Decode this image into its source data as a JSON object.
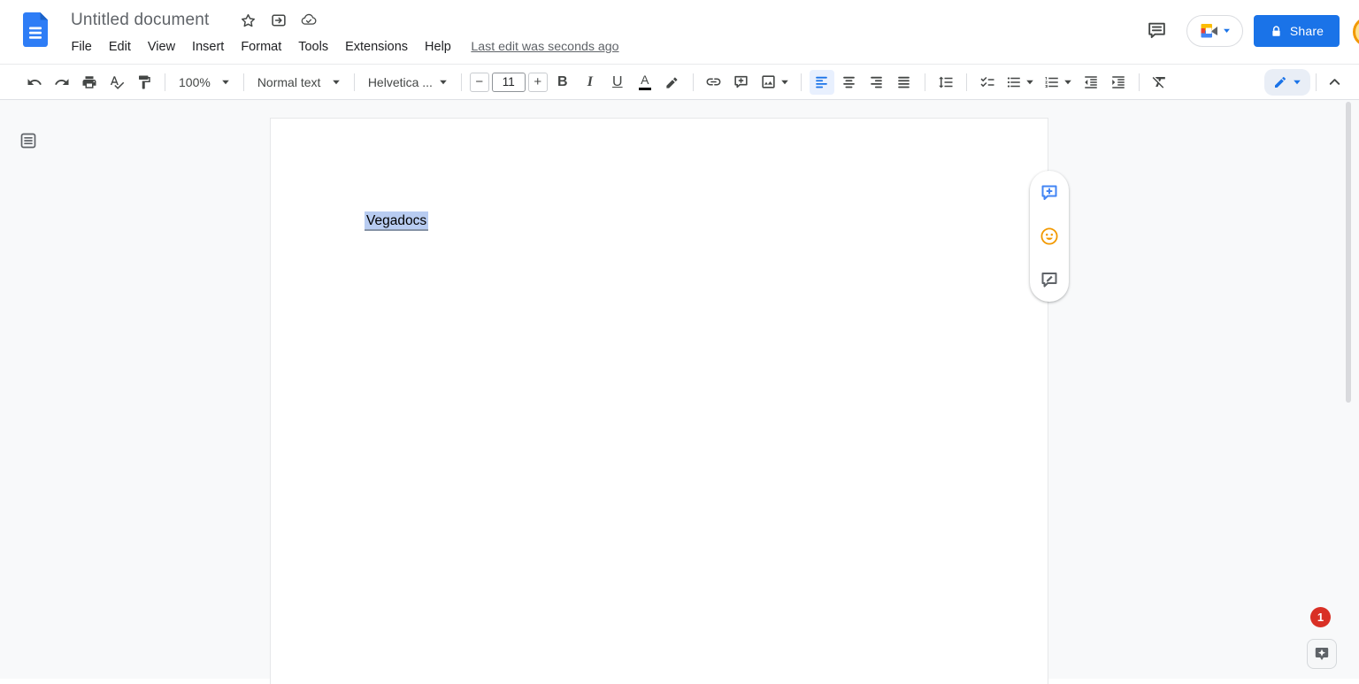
{
  "header": {
    "title": "Untitled document",
    "menus": [
      "File",
      "Edit",
      "View",
      "Insert",
      "Format",
      "Tools",
      "Extensions",
      "Help"
    ],
    "last_edit": "Last edit was seconds ago",
    "share_label": "Share"
  },
  "toolbar": {
    "zoom": "100%",
    "paragraph_style": "Normal text",
    "font": "Helvetica ...",
    "font_size": "11",
    "minus": "−",
    "plus": "+",
    "bold_label": "B",
    "italic_label": "I",
    "underline_label": "U",
    "text_color_label": "A"
  },
  "document": {
    "selected_text": "Vegadocs"
  },
  "notifications": {
    "badge_count": "1"
  },
  "colors": {
    "accent": "#1a73e8",
    "share_button": "#1a73e8",
    "selection": "#b8ccf1",
    "badge": "#d93025",
    "emoji": "#f29900",
    "docs_icon": "#2e7df6"
  }
}
